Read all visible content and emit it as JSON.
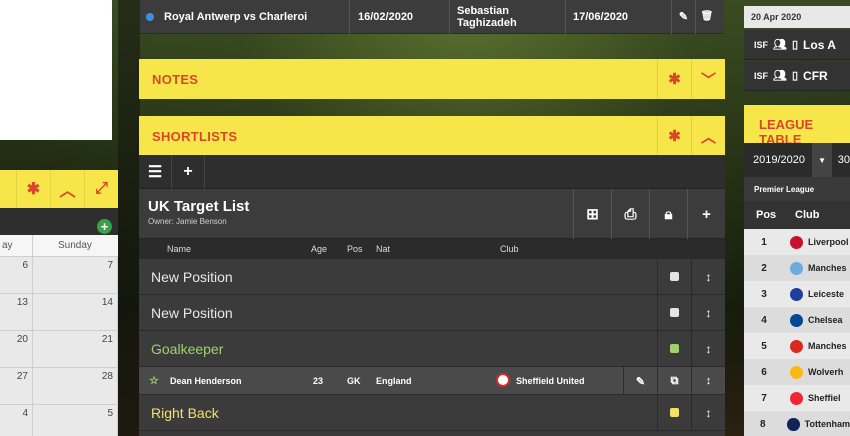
{
  "calendar": {
    "days": [
      "ay",
      "Sunday"
    ],
    "weeks": [
      [
        "6",
        "7"
      ],
      [
        "13",
        "14"
      ],
      [
        "20",
        "21"
      ],
      [
        "27",
        "28"
      ],
      [
        "4",
        "5"
      ]
    ]
  },
  "match": {
    "teams": "Royal Antwerp vs Charleroi",
    "date1": "16/02/2020",
    "scout": "Sebastian Taghizadeh",
    "date2": "17/06/2020"
  },
  "notes": {
    "title": "NOTES"
  },
  "shortlists": {
    "title": "SHORTLISTS",
    "list_name": "UK Target List",
    "owner": "Owner: Jamie Benson",
    "columns": {
      "name": "Name",
      "age": "Age",
      "pos": "Pos",
      "nat": "Nat",
      "club": "Club"
    },
    "rows": [
      {
        "label": "New Position",
        "label_color": "#e8e8e8",
        "square_color": "#e4e4e4"
      },
      {
        "label": "New Position",
        "label_color": "#e8e8e8",
        "square_color": "#e4e4e4"
      },
      {
        "label": "Goalkeeper",
        "label_color": "#9fd36a",
        "square_color": "#9fd36a"
      }
    ],
    "player": {
      "name": "Dean Henderson",
      "age": "23",
      "pos": "GK",
      "nat": "England",
      "club": "Sheffield United"
    },
    "last_row": {
      "label": "Right Back",
      "label_color": "#f5e06a",
      "square_color": "#f5e06a"
    }
  },
  "right": {
    "date": "20 Apr 2020",
    "items": [
      {
        "tag": "ISF",
        "text": "Los A"
      },
      {
        "tag": "ISF",
        "text": "CFR"
      }
    ],
    "league_table_title": "LEAGUE TABLE",
    "season": "2019/2020",
    "season_next": "30",
    "league": "Premier League",
    "th_pos": "Pos",
    "th_club": "Club",
    "table": [
      {
        "pos": "1",
        "club": "Liverpool",
        "crest": "#c8102e"
      },
      {
        "pos": "2",
        "club": "Manches",
        "crest": "#6cabdd"
      },
      {
        "pos": "3",
        "club": "Leiceste",
        "crest": "#1e3f9a"
      },
      {
        "pos": "4",
        "club": "Chelsea",
        "crest": "#034694"
      },
      {
        "pos": "5",
        "club": "Manches",
        "crest": "#da291c"
      },
      {
        "pos": "6",
        "club": "Wolverh",
        "crest": "#fdb913"
      },
      {
        "pos": "7",
        "club": "Sheffiel",
        "crest": "#ee2737"
      },
      {
        "pos": "8",
        "club": "Tottenham",
        "crest": "#132257"
      }
    ]
  },
  "colors": {
    "accent_yellow": "#f7e64a",
    "accent_red": "#d9472b"
  }
}
